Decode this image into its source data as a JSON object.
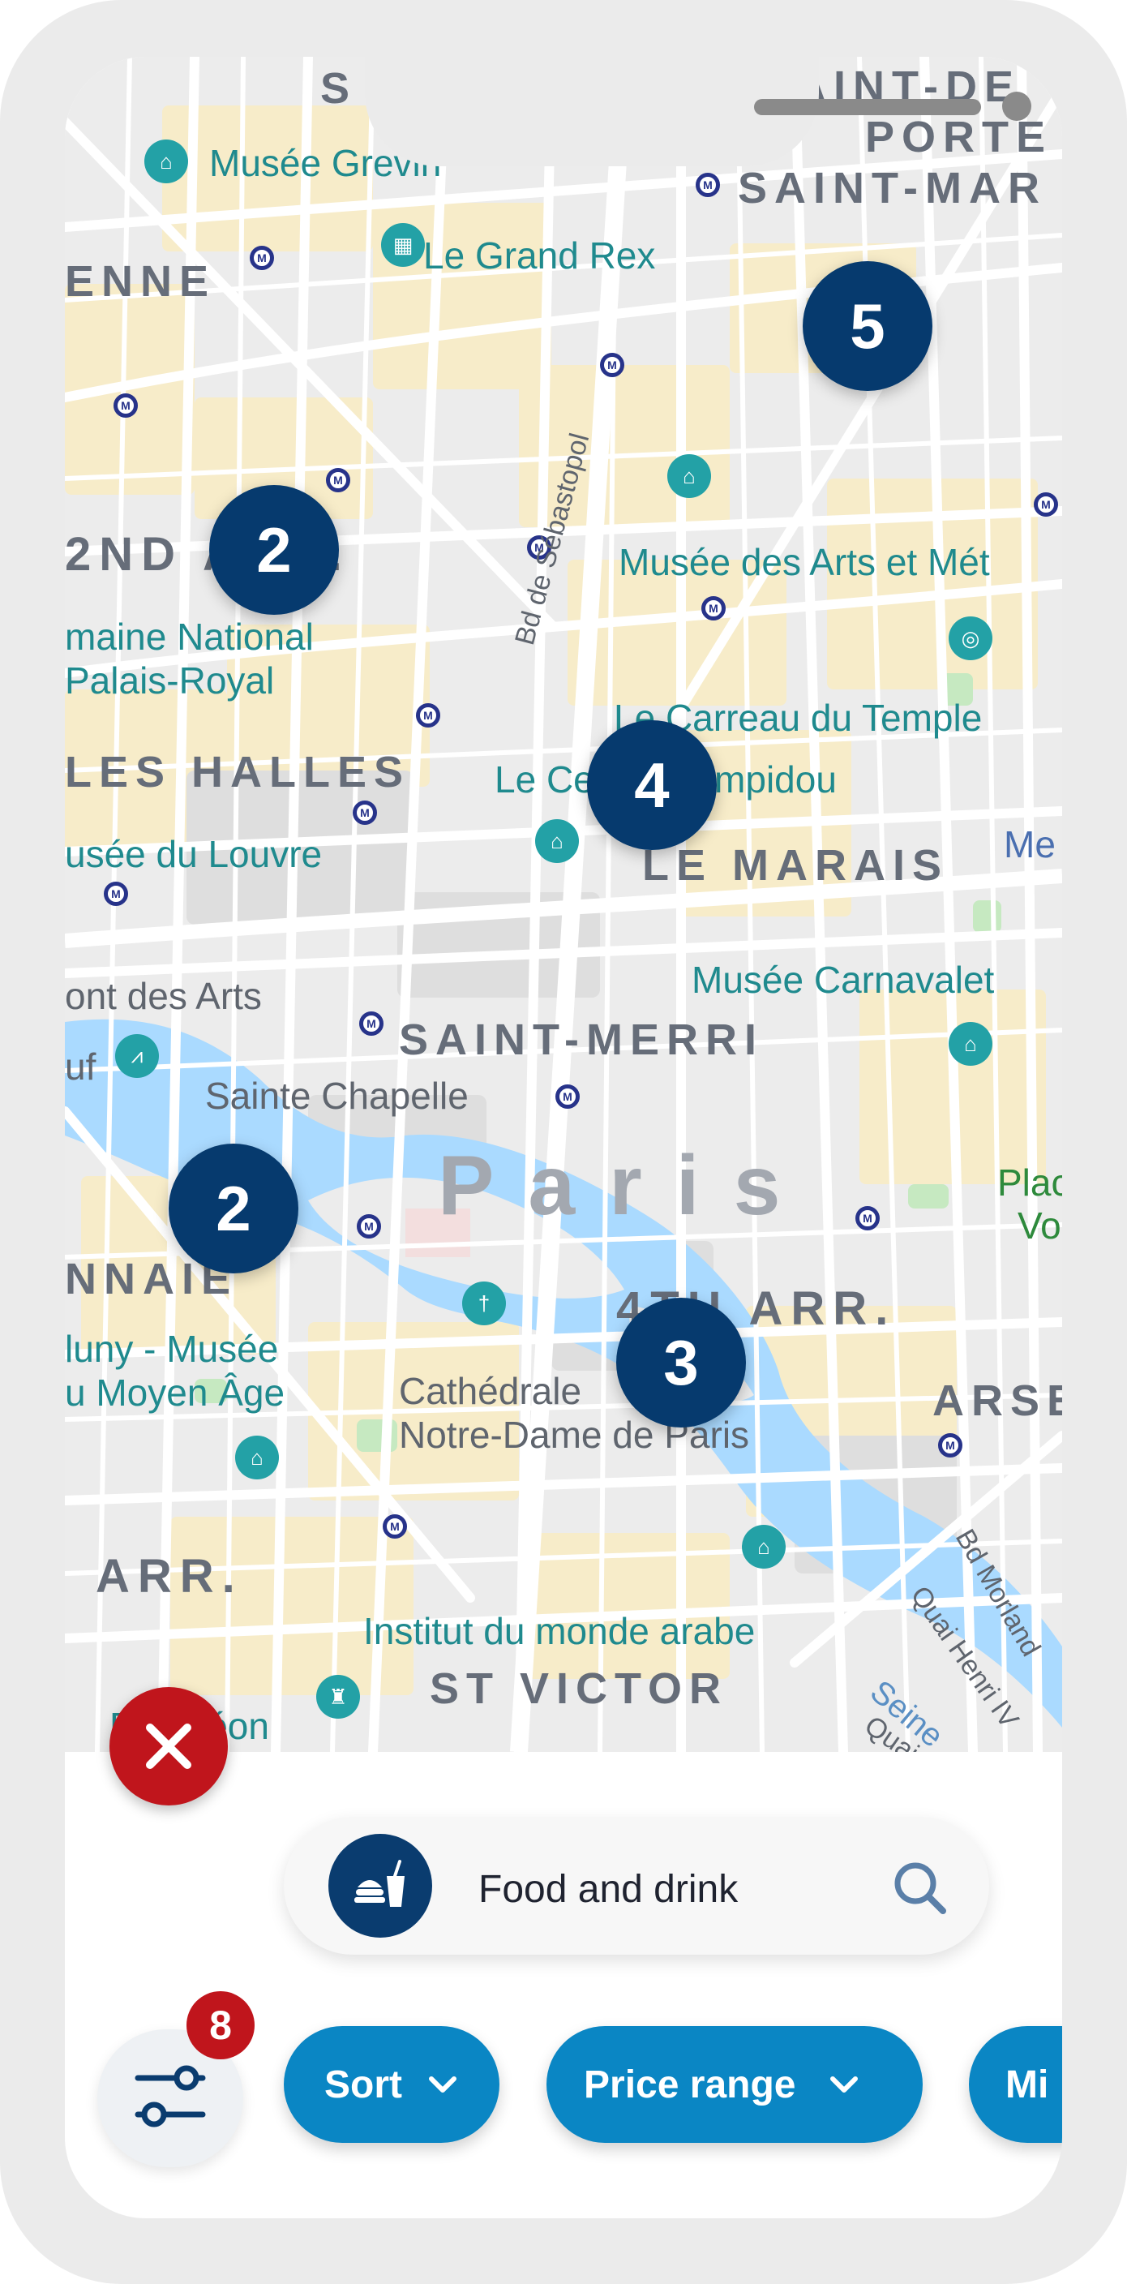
{
  "map": {
    "poi_labels": {
      "musee_grevin": "Musée Grevin",
      "le_grand_rex": "Le Grand Rex",
      "musee_arts_metiers": "Musée des Arts et Mét",
      "domaine_national": "maine National",
      "palais_royal": "Palais-Royal",
      "carreau_du_temple": "Le Carreau du Temple",
      "centre_pompidou": "Le Centre Pompidou",
      "musee_du_louvre": "usée du Louvre",
      "musee_carnavalet": "Musée Carnavalet",
      "pont_des_arts": "ont des Arts",
      "sainte_chapelle": "Sainte Chapelle",
      "cluny_1": "luny - Musée",
      "cluny_2": "u Moyen Âge",
      "notre_dame_1": "Cathédrale",
      "notre_dame_2": "Notre-Dame de Paris",
      "institut_monde_arabe": "Institut du monde arabe",
      "pantheon": "Panthéon",
      "place_vosges_1": "Plac",
      "place_vosges_2": "Vo",
      "me_partial": "Me",
      "uf_partial": "uf"
    },
    "districts": {
      "saint_denis_1": "AINT-DE",
      "saint_denis_2": "PORTE",
      "saint_martin": "SAINT-MAR",
      "s_top": "S",
      "enne": "ENNE",
      "second_arr": "2ND ARR.",
      "les_halles": "LES HALLES",
      "le_marais": "LE MARAIS",
      "saint_merri": "SAINT-MERRI",
      "nnaie": "NNAIE",
      "fourth_arr": "4TH ARR.",
      "arsenal": "ARSE",
      "fifth_arr": "ARR.",
      "st_victor": "ST VICTOR"
    },
    "city_label": "Paris",
    "streets": {
      "sebastopol": "Bd de Sébastopol",
      "seine": "Seine",
      "bd_morland": "Bd Morland",
      "quai_henri": "Quai Henri IV",
      "quai_s": "Quai S"
    },
    "clusters": [
      "5",
      "2",
      "4",
      "2",
      "3"
    ]
  },
  "close_button": {
    "icon": "close-icon",
    "label": "×"
  },
  "search": {
    "category": "Food and drink",
    "category_icon": "food-drink-icon",
    "search_icon": "search-icon"
  },
  "filters": {
    "badge_count": "8",
    "icon": "sliders-icon"
  },
  "chips": [
    {
      "label": "Sort"
    },
    {
      "label": "Price range"
    },
    {
      "label": "Mi"
    }
  ],
  "colors": {
    "cluster": "#063a6e",
    "accent": "#0a86c4",
    "close": "#c0151c",
    "water": "#aadaff",
    "poi": "#1f8a8e"
  }
}
